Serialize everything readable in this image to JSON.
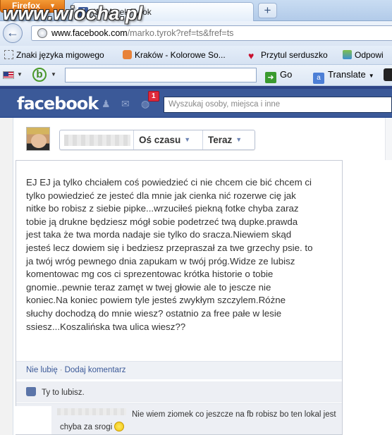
{
  "browser": {
    "menu_button": "Firefox",
    "tab_title": "(1) Marek Tyrok",
    "new_tab": "+",
    "url_domain": "www.facebook.com",
    "url_path": "/marko.tyrok?ref=ts&fref=ts",
    "watermark": "www.wiocha.pl",
    "bookmarks": [
      "Znaki języka migowego",
      "Kraków - Kolorowe So...",
      "Przytul serduszko",
      "Odpowi"
    ],
    "toolbar": {
      "go_label": "Go",
      "translate_label": "Translate"
    }
  },
  "facebook": {
    "logo": "facebook",
    "notification_count": "1",
    "search_placeholder": "Wyszukaj osoby, miejsca i inne",
    "timeline_bar": {
      "timeline_label": "Oś czasu",
      "now_label": "Teraz"
    },
    "post": {
      "text": "EJ EJ ja tylko chciałem coś powiedzieć ci nie chcem cie bić chcem ci\ntylko powiedzieć ze jesteć dla mnie jak cienka nić rozerwe cię jak\nnitke bo robisz z siebie pipke...wrzuciłeś piekną fotke chyba zaraz\ntobie ją drukne będziesz mógł sobie podetrzeć twą dupke.prawda\njest taka że twa morda nadaje sie tylko do sracza.Niewiem skąd\njesteś lecz dowiem się i bedziesz przepraszał za twe grzechy psie. to\nja twój wróg pewnego dnia zapukam w twój próg.Widze ze lubisz\nkomentowac mg cos ci sprezentowac krótka historie o tobie\ngnomie..pewnie teraz zamęt w twej głowie ale to jescze nie\nkoniec.Na koniec powiem tyle jesteś zwykłym szczylem.Różne\nsłuchy dochodzą do mnie wiesz? ostatnio za free pałe w lesie\nssiesz...Koszalińska twa ulica wiesz??",
      "unlike_label": "Nie lubię",
      "comment_label": "Dodaj komentarz",
      "likes_text": "Ty to lubisz.",
      "comment_text": "Nie wiem ziomek co jeszcze na fb robisz bo ten lokal jest chyba za srogi"
    }
  }
}
